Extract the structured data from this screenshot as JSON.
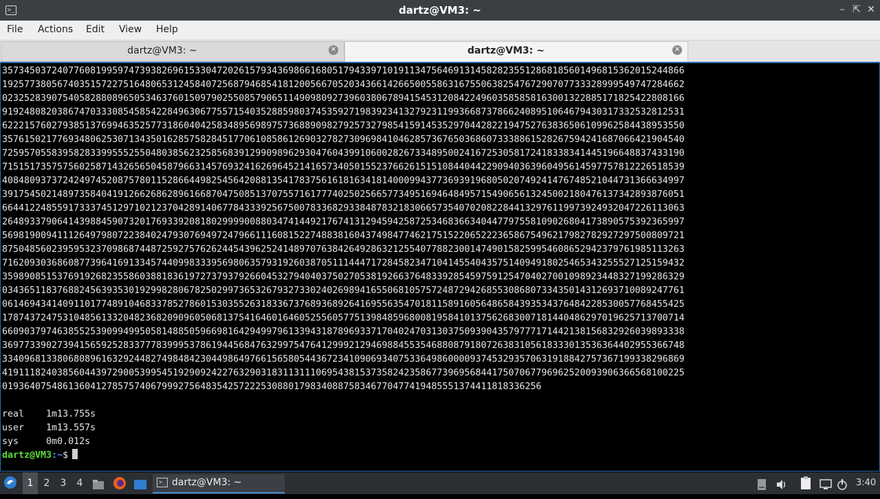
{
  "window": {
    "title": "dartz@VM3: ~",
    "icon": "terminal-icon",
    "controls": [
      "minimize-icon",
      "maximize-icon",
      "close-icon"
    ]
  },
  "menu": {
    "file": "File",
    "actions": "Actions",
    "edit": "Edit",
    "view": "View",
    "help": "Help"
  },
  "tabs": [
    {
      "label": "dartz@VM3: ~",
      "active": false
    },
    {
      "label": "dartz@VM3: ~",
      "active": true
    }
  ],
  "terminal": {
    "output": "3573450372407760819959747393826961533047202615793436986616805179433971019113475646913145828235512868185601496815362015244866\n1925773805674035157227516480653124584072568794685418120056670520343661426650055863167550638254767290707733328999549747284662\n0232528390754058288089650534637601509790255085790651149098092739603806789415453120842249603585858163001322885171825422808166\n9192480820386747033308545854228496306775571540352885980374535927198392341327923119936687378662408951064679430317332532812531\n6222157602793851376994635257731860404258348956989757368890982792573279854159145352970442822194752763836506109962584438953550\n3576150217769348062530713435016285758284517706108586126903278273096984104628573676503686073338861528267594241687066421904540\n7259570558395828339955525504803856232585683912990989629304760439910600282673348950024167253058172418338341445196648837433190\n7151517357575602587143265650458796631457693241626964521416573405015523766261515108440442290940363960495614597757812226518539\n4084809373724249745208757801152866449825456420881354178375616181634181400099437736939196805020749241476748521044731366634997\n3917545021489735840419126626862896166870475085137075571617774025025665773495169464849571549065613245002180476137342893876051\n6644122485591733374512971021237042891406778433392567500783368293384878321830665735407020822844132976119973924932047226113063\n2648933790641439884590732017693392081802999900880347414492176741312945942587253468366340447797558109026804173890575392365997\n5698190094111264979807223840247930769497247966111608152274883816043749847746217515220652223658675496217982782927297500809721\n8750485602395953237098687448725927576262445439625241489707638426492863212554077882300147490158259954608652942379761985113263\n7162093036860877396416913345744099833395698063579319260387051114447172845823471041455404357514094918025465343255527125159432\n3598908515376919268235586038818361972737937926604532794040375027053819266376483392854597591254704027001098923448327199286329\n0343651183768824563935301929982806782502997365326793273302402698941655068105757248729426855308680733435014312693710089247761\n0614694341409110177489104683378527860153035526318336737689368926416955635470181158916056486584393534376484228530057768455425\n1787437247531048561332048236820909605068137541646016460525560577513984859680081958410137562683007181440486297019625713700714\n6609037974638552539099499505814885059669816429499796133943187896933717040247031303750939043579777171442138156832926039893338\n3697733902739415659252833777839995378619445684763299754764129992129469884553546880879180726383105618333013536364402955366748\n3340968133806808961632924482749848423044986497661565805443672341090693407533649860000937453293570631918842757367199338296869\n4191118240385604439729005399545192909242276329031831131110695438153735824235867739695684417507067796962520093906366568100225\n01936407548613604127857574067999275648354257222530880179834088758346770477419485551374411818336256\n\nreal\t1m13.755s\nuser\t1m13.557s\nsys\t0m0.012s",
    "prompt_user": "dartz@VM3",
    "prompt_path": ":~",
    "prompt_dollar": "$"
  },
  "taskbar": {
    "start_icon": "app-menu-icon",
    "workspaces": [
      "1",
      "2",
      "3",
      "4"
    ],
    "active_workspace": "1",
    "launchers": [
      "file-manager-icon",
      "firefox-icon",
      "desktop-icon"
    ],
    "task": {
      "label": "dartz@VM3: ~",
      "icon": "terminal-icon"
    },
    "tray": [
      "drive-icon",
      "volume-icon",
      "clipboard-icon",
      "network-icon",
      "power-icon"
    ],
    "clock": "3:40"
  }
}
